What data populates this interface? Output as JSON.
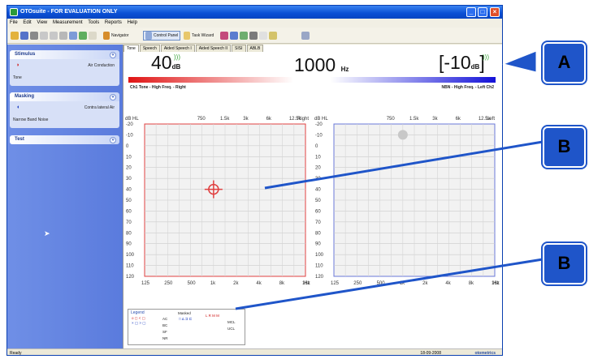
{
  "window": {
    "title": "OTOsuite - FOR EVALUATION ONLY"
  },
  "menu": [
    "File",
    "Edit",
    "View",
    "Measurement",
    "Tools",
    "Reports",
    "Help"
  ],
  "toolbar": {
    "navigator": "Navigator",
    "control_panel": "Control Panel",
    "task_wizard": "Task Wizard"
  },
  "sidebar": {
    "stimulus": {
      "title": "Stimulus",
      "transducer": "Air Conduction",
      "type": "Tone"
    },
    "masking": {
      "title": "Masking",
      "transducer": "Contra lateral Air",
      "type": "Narrow Band Noise"
    },
    "test": {
      "title": "Test"
    }
  },
  "tabs": [
    "Tone",
    "Speech",
    "Aided Speech I",
    "Aided Speech II",
    "SISI",
    "ABLB"
  ],
  "display": {
    "level": "40",
    "level_unit": "dB",
    "frequency": "1000",
    "frequency_unit": "Hz",
    "masking": "[-10",
    "masking_unit": "dB",
    "masking_close": "]",
    "left_label": "Ch1 Tone - High Freq. - Right",
    "right_label": "NBN - High Freq. - Left Ch2"
  },
  "audiogram": {
    "y_label": "dB HL",
    "y_ticks": [
      "-20",
      "-10",
      "0",
      "10",
      "20",
      "30",
      "40",
      "50",
      "60",
      "70",
      "80",
      "90",
      "100",
      "110",
      "120"
    ],
    "x_top": [
      "750",
      "1.5k",
      "3k",
      "6k",
      "12.5k"
    ],
    "x_bottom": [
      "125",
      "250",
      "500",
      "1k",
      "2k",
      "4k",
      "8k",
      "16k"
    ],
    "x_unit": "Hz",
    "right_ear": "Right",
    "left_ear": "Left",
    "right_color": "#e04040",
    "left_color": "#6a78d8",
    "right_cursor": {
      "freq_hz": 1000,
      "db": 40
    },
    "left_marker": {
      "freq_hz": 1000,
      "db": -10
    }
  },
  "legend": {
    "title": "Legend",
    "rows": [
      "AC",
      "BC",
      "SF",
      "NR"
    ],
    "masked": "Masked",
    "extra": [
      "MCL",
      "UCL"
    ]
  },
  "status": {
    "left": "Ready",
    "date": "18-09-2008",
    "brand": "otometrics"
  },
  "callouts": {
    "a": "A",
    "b1": "B",
    "b2": "B"
  }
}
